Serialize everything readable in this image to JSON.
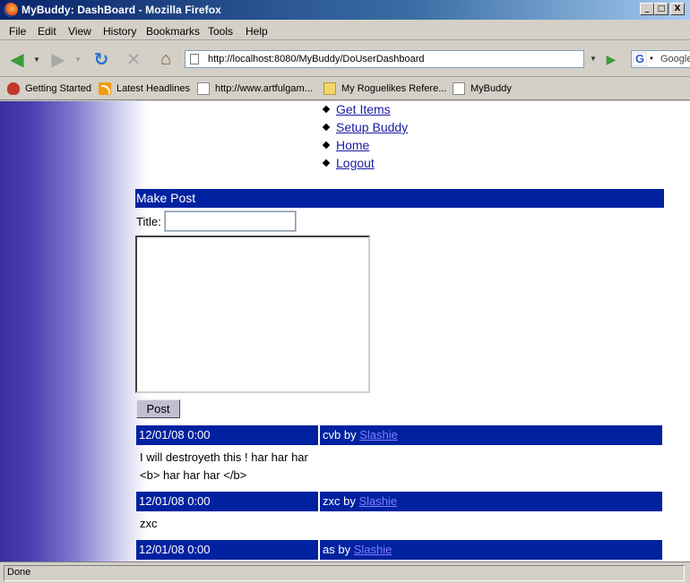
{
  "window": {
    "title": "MyBuddy: DashBoard - Mozilla Firefox",
    "minimize": "_",
    "maximize": "□",
    "close": "X"
  },
  "menu": {
    "items": [
      "File",
      "Edit",
      "View",
      "History",
      "Bookmarks",
      "Tools",
      "Help"
    ]
  },
  "toolbar": {
    "url": "http://localhost:8080/MyBuddy/DoUserDashboard",
    "search_placeholder": "Google"
  },
  "bookmarks": {
    "items": [
      "Getting Started",
      "Latest Headlines",
      "http://www.artfulgam...",
      "My Roguelikes Refere...",
      "MyBuddy"
    ]
  },
  "page": {
    "nav_links": [
      "Get Items",
      "Setup Buddy",
      "Home",
      "Logout"
    ],
    "make_post_header": "Make Post",
    "title_label": "Title:",
    "title_value": "",
    "body_value": "",
    "post_button": "Post",
    "posts": [
      {
        "date": "12/01/08 0:00",
        "title": "cvb",
        "by": "by",
        "author": "Slashie",
        "body_lines": [
          "I will destroyeth this ! har har har",
          "<b> har har har </b>"
        ]
      },
      {
        "date": "12/01/08 0:00",
        "title": "zxc",
        "by": "by",
        "author": "Slashie",
        "body_lines": [
          "zxc"
        ]
      },
      {
        "date": "12/01/08 0:00",
        "title": "as",
        "by": "by",
        "author": "Slashie",
        "body_lines": []
      }
    ]
  },
  "status": {
    "text": "Done"
  }
}
